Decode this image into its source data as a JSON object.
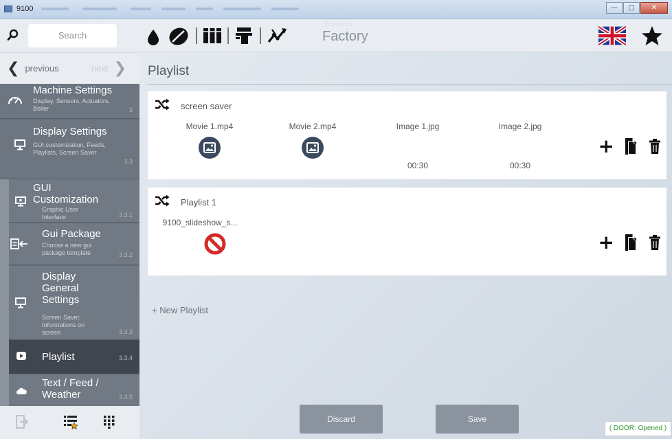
{
  "window": {
    "title": "9100"
  },
  "sidebar": {
    "search_placeholder": "Search",
    "previous_label": "previous",
    "next_label": "next",
    "items": [
      {
        "title": "Machine Settings",
        "desc": "Display, Sensors, Actuators, Boiler",
        "num": "3"
      },
      {
        "title": "Display Settings",
        "desc": "GUI customization, Feeds, Playlists, Screen Saver",
        "num": "3.3"
      },
      {
        "title": "GUI Customization",
        "desc": "Graphic User Interface",
        "num": "3.3.1"
      },
      {
        "title": "Gui Package",
        "desc": "Choose a new gui package template",
        "num": "3.3.2"
      },
      {
        "title": "Display General Settings",
        "desc": "Screen Saver, Informations on screen",
        "num": "3.3.3"
      },
      {
        "title": "Playlist",
        "desc": "",
        "num": "3.3.4"
      },
      {
        "title": "Text / Feed / Weather",
        "desc": "",
        "num": "3.3.5"
      }
    ]
  },
  "topbar": {
    "section": "Factory"
  },
  "page": {
    "title": "Playlist",
    "playlists": [
      {
        "name": "screen saver",
        "media": [
          {
            "file": "Movie 1.mp4",
            "duration": ""
          },
          {
            "file": "Movie 2.mp4",
            "duration": ""
          },
          {
            "file": "Image 1.jpg",
            "duration": "00:30"
          },
          {
            "file": "Image 2.jpg",
            "duration": "00:30"
          }
        ]
      },
      {
        "name": "Playlist 1",
        "media": [
          {
            "file": "9100_slideshow_s...",
            "duration": ""
          }
        ]
      }
    ],
    "new_playlist": "+ New Playlist"
  },
  "footer": {
    "discard": "Discard",
    "save": "Save",
    "door_status": "( DOOR: Opened )"
  },
  "colors": {
    "sidebar": "#606975",
    "selected": "#3f4650",
    "accent_green": "#2f9a2f",
    "no_entry_red": "#d42a2a",
    "button": "#8a939e"
  }
}
